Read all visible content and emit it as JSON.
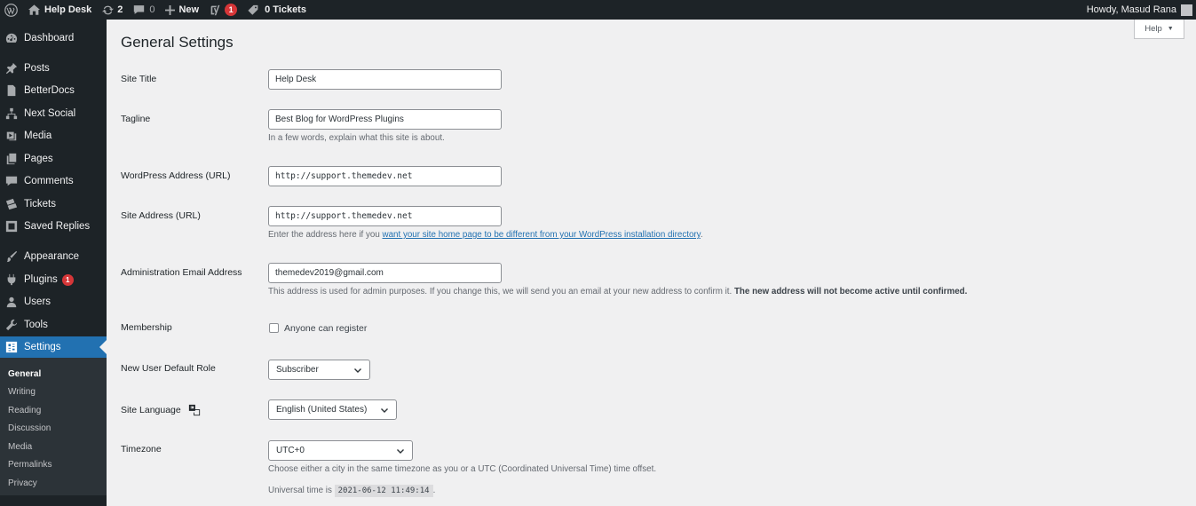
{
  "adminbar": {
    "site_name": "Help Desk",
    "updates_count": "2",
    "comments_count": "0",
    "new_label": "New",
    "yoast_count": "1",
    "tickets_label": "0 Tickets",
    "howdy": "Howdy, Masud Rana"
  },
  "sidebar": {
    "items": [
      {
        "label": "Dashboard",
        "icon": "dashboard-icon"
      },
      {
        "label": "Posts",
        "icon": "pin-icon"
      },
      {
        "label": "BetterDocs",
        "icon": "docs-icon"
      },
      {
        "label": "Next Social",
        "icon": "social-icon"
      },
      {
        "label": "Media",
        "icon": "media-icon"
      },
      {
        "label": "Pages",
        "icon": "pages-icon"
      },
      {
        "label": "Comments",
        "icon": "comment-icon"
      },
      {
        "label": "Tickets",
        "icon": "tickets-icon"
      },
      {
        "label": "Saved Replies",
        "icon": "replies-icon"
      },
      {
        "label": "Appearance",
        "icon": "brush-icon"
      },
      {
        "label": "Plugins",
        "icon": "plugin-icon",
        "badge": "1"
      },
      {
        "label": "Users",
        "icon": "users-icon"
      },
      {
        "label": "Tools",
        "icon": "wrench-icon"
      },
      {
        "label": "Settings",
        "icon": "settings-icon"
      }
    ],
    "submenu": [
      "General",
      "Writing",
      "Reading",
      "Discussion",
      "Media",
      "Permalinks",
      "Privacy"
    ]
  },
  "page": {
    "title": "General Settings",
    "help_label": "Help"
  },
  "form": {
    "site_title_label": "Site Title",
    "site_title_value": "Help Desk",
    "tagline_label": "Tagline",
    "tagline_value": "Best Blog for WordPress Plugins",
    "tagline_desc": "In a few words, explain what this site is about.",
    "wp_address_label": "WordPress Address (URL)",
    "wp_address_value": "http://support.themedev.net",
    "site_address_label": "Site Address (URL)",
    "site_address_value": "http://support.themedev.net",
    "site_address_desc_pre": "Enter the address here if you ",
    "site_address_desc_link": "want your site home page to be different from your WordPress installation directory",
    "site_address_desc_post": ".",
    "admin_email_label": "Administration Email Address",
    "admin_email_value": "themedev2019@gmail.com",
    "admin_email_desc": "This address is used for admin purposes. If you change this, we will send you an email at your new address to confirm it.",
    "admin_email_desc_strong": "The new address will not become active until confirmed.",
    "membership_label": "Membership",
    "membership_checkbox_label": "Anyone can register",
    "default_role_label": "New User Default Role",
    "default_role_value": "Subscriber",
    "site_language_label": "Site Language",
    "site_language_value": "English (United States)",
    "timezone_label": "Timezone",
    "timezone_value": "UTC+0",
    "timezone_desc": "Choose either a city in the same timezone as you or a UTC (Coordinated Universal Time) time offset.",
    "universal_time_label": "Universal time is",
    "universal_time_value": "2021-06-12 11:49:14",
    "universal_time_post": "."
  }
}
